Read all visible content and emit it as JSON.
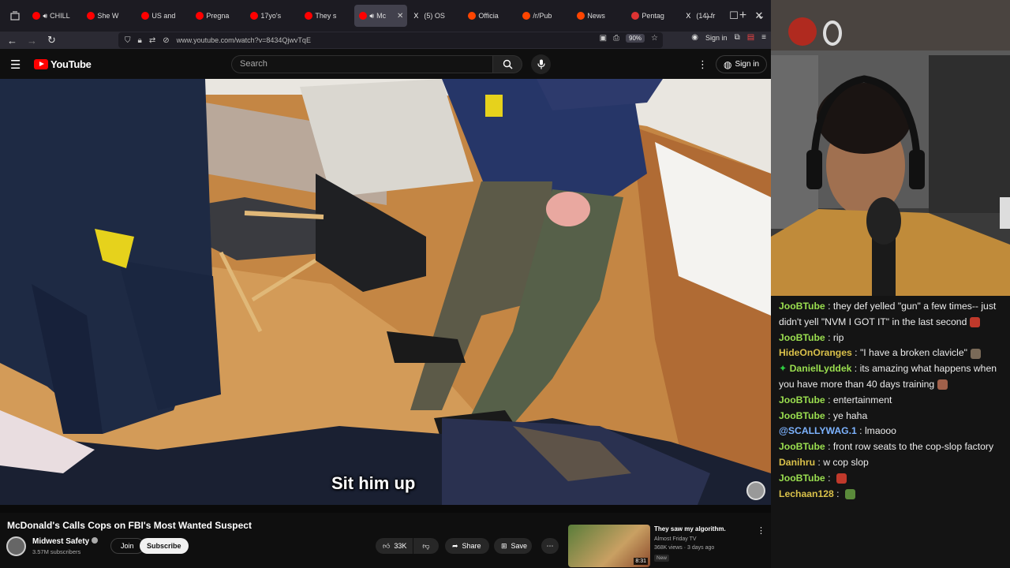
{
  "browser": {
    "tabs": [
      {
        "label": "CHILL",
        "audio": true,
        "color": "#ff0000"
      },
      {
        "label": "She W",
        "audio": false,
        "color": "#ff0000"
      },
      {
        "label": "US and",
        "audio": false,
        "color": "#ff0000"
      },
      {
        "label": "Pregna",
        "audio": false,
        "color": "#ff0000"
      },
      {
        "label": "17yo's",
        "audio": false,
        "color": "#ff0000"
      },
      {
        "label": "They s",
        "audio": false,
        "color": "#ff0000"
      },
      {
        "label": "Mc",
        "audio": true,
        "color": "#ff0000",
        "active": true
      },
      {
        "label": "(5) OS",
        "audio": false,
        "color": "#ffffff",
        "glyph": "X"
      },
      {
        "label": "Officia",
        "audio": false,
        "color": "#ff4500"
      },
      {
        "label": "/r/Pub",
        "audio": false,
        "color": "#ff4500"
      },
      {
        "label": "News",
        "audio": false,
        "color": "#ff4500"
      },
      {
        "label": "Pentag",
        "audio": false,
        "color": "#d33"
      },
      {
        "label": "(14) fr",
        "audio": false,
        "color": "#ffffff",
        "glyph": "X"
      }
    ],
    "url": "www.youtube.com/watch?v=8434QjwvTqE",
    "zoom": "90%",
    "signin_label": "Sign in"
  },
  "youtube": {
    "logo_text": "YouTube",
    "search_placeholder": "Search",
    "signin_label": "Sign in",
    "subtitle": "Sit him up",
    "video_title": "McDonald's Calls Cops on FBI's Most Wanted Suspect",
    "channel_name": "Midwest Safety",
    "subscribers": "3.57M subscribers",
    "join_label": "Join",
    "subscribe_label": "Subscribe",
    "like_count": "33K",
    "share_label": "Share",
    "save_label": "Save",
    "recommendation": {
      "title": "They saw my algorithm.",
      "channel": "Almost Friday TV",
      "views": "368K views · 3 days ago",
      "badge": "New",
      "duration": "8:31"
    }
  },
  "chat": [
    {
      "user": "JooBTube",
      "color": "#9ade4f",
      "text": "they def yelled \"gun\" a few times-- just didn't yell \"NVM I GOT IT\" in the last second",
      "emote": "#c0392b"
    },
    {
      "user": "JooBTube",
      "color": "#9ade4f",
      "text": "rip"
    },
    {
      "user": "HideOnOranges",
      "color": "#d9c04a",
      "text": "\"I have a broken clavicle\"",
      "emote": "#7a6a58"
    },
    {
      "user": "DanielLyddek",
      "color": "#9ade4f",
      "text": "its amazing what happens when you have more than 40 days training",
      "emote": "#a0604a",
      "badge": true
    },
    {
      "user": "JooBTube",
      "color": "#9ade4f",
      "text": "entertainment"
    },
    {
      "user": "JooBTube",
      "color": "#9ade4f",
      "text": "ye haha"
    },
    {
      "user": "@SCALLYWAG.1",
      "color": "#7db3ff",
      "text": "lmaooo"
    },
    {
      "user": "JooBTube",
      "color": "#9ade4f",
      "text": "front row seats to the cop-slop factory"
    },
    {
      "user": "Danihru",
      "color": "#d9c04a",
      "text": "w cop slop"
    },
    {
      "user": "JooBTube",
      "color": "#9ade4f",
      "text": "",
      "emote": "#c0392b"
    },
    {
      "user": "Lechaan128",
      "color": "#d9c04a",
      "text": "",
      "emote": "#5a8a3a"
    }
  ]
}
